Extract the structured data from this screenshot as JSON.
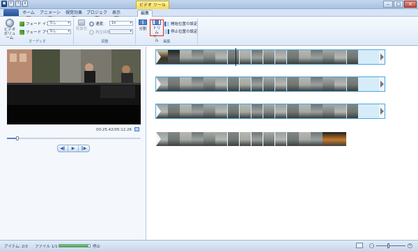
{
  "titlebar": {
    "context_tab": "ビデオ ツール",
    "quick_access": [
      "▣",
      "↶",
      "↷",
      "▾"
    ]
  },
  "tabs": {
    "file": "",
    "items": [
      {
        "label": "ホーム",
        "key": "H"
      },
      {
        "label": "アニメーション",
        "key": "A"
      },
      {
        "label": "視覚効果",
        "key": "S"
      },
      {
        "label": "プロジェクト",
        "key": "P"
      },
      {
        "label": "表示",
        "key": "W"
      },
      {
        "label": "編集",
        "key": "V"
      }
    ]
  },
  "ribbon": {
    "audio": {
      "group_label": "オーディオ",
      "volume_label_1": "ビデオ",
      "volume_label_2": "ボリューム",
      "fade_in_label": "フェード イン:",
      "fade_in_value": "なし",
      "fade_out_label": "フェード アウト:",
      "fade_out_value": "なし"
    },
    "adjust": {
      "group_label": "調整",
      "background_color_label": "背景色",
      "speed_label": "速度:",
      "speed_value": "1x",
      "duration_label": "再生時間:",
      "duration_value": ""
    },
    "edit": {
      "group_label": "編集",
      "split_label": "分割",
      "trim_label_1": "トリム",
      "trim_label_2": "ツール",
      "set_start_label": "開始位置の設定",
      "set_end_label": "停止位置の設定"
    }
  },
  "preview": {
    "timecode": "00:25.42/05:12.26",
    "position_fraction": 0.08
  },
  "storyboard": {
    "strips": [
      {
        "frames": 17
      },
      {
        "frames": 17
      },
      {
        "frames": 17
      },
      {
        "frames": 16
      }
    ]
  },
  "statusbar": {
    "items_label": "アイテム: 2/3",
    "file_label": "ファイル 1/1",
    "progress_percent": 95,
    "stop_label": "停止"
  },
  "colors": {
    "accent": "#2a5fa8",
    "selection_border": "#48a9dc",
    "highlight_red": "#e0231b",
    "context_tab_yellow": "#f3d94e"
  }
}
